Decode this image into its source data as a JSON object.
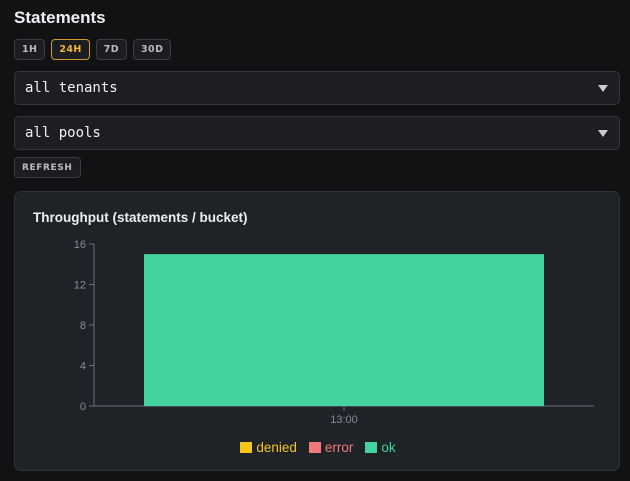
{
  "page": {
    "title": "Statements"
  },
  "time_ranges": [
    {
      "label": "1H",
      "active": false
    },
    {
      "label": "24H",
      "active": true
    },
    {
      "label": "7D",
      "active": false
    },
    {
      "label": "30D",
      "active": false
    }
  ],
  "filters": {
    "tenant": {
      "value": "all tenants"
    },
    "pool": {
      "value": "all pools"
    }
  },
  "refresh": {
    "label": "REFRESH"
  },
  "chart": {
    "title": "Throughput (statements / bucket)",
    "legend": [
      {
        "label": "denied",
        "color": "#f5c518"
      },
      {
        "label": "error",
        "color": "#f07a7a"
      },
      {
        "label": "ok",
        "color": "#43d39e"
      }
    ]
  },
  "chart_data": {
    "type": "bar",
    "title": "Throughput (statements / bucket)",
    "stacked": true,
    "categories": [
      "13:00"
    ],
    "series": [
      {
        "name": "denied",
        "values": [
          0
        ],
        "color": "#f5c518"
      },
      {
        "name": "error",
        "values": [
          0
        ],
        "color": "#f07a7a"
      },
      {
        "name": "ok",
        "values": [
          15
        ],
        "color": "#43d39e"
      }
    ],
    "ylim": [
      0,
      16
    ],
    "yticks": [
      0,
      4,
      8,
      12,
      16
    ],
    "grid": false,
    "legend_position": "bottom"
  }
}
